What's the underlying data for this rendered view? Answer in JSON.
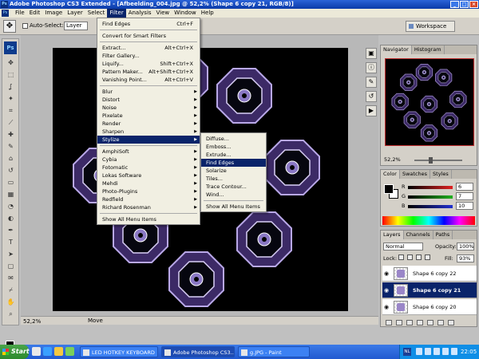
{
  "title": "Adobe Photoshop CS3 Extended - [Afbeelding_004.jpg @ 52,2% (Shape 6 copy 21, RGB/8)]",
  "app_logo": "Ps",
  "menubar": [
    "File",
    "Edit",
    "Image",
    "Layer",
    "Select",
    "Filter",
    "Analysis",
    "View",
    "Window",
    "Help"
  ],
  "options": {
    "auto_select_label": "Auto-Select:",
    "auto_select_value": "Layer",
    "workspace": "Workspace"
  },
  "filter_menu": {
    "items": [
      {
        "label": "Find Edges",
        "shortcut": "Ctrl+F"
      },
      {
        "sep": true
      },
      {
        "label": "Convert for Smart Filters"
      },
      {
        "sep": true
      },
      {
        "label": "Extract...",
        "shortcut": "Alt+Ctrl+X"
      },
      {
        "label": "Filter Gallery..."
      },
      {
        "label": "Liquify...",
        "shortcut": "Shift+Ctrl+X"
      },
      {
        "label": "Pattern Maker...",
        "shortcut": "Alt+Shift+Ctrl+X"
      },
      {
        "label": "Vanishing Point...",
        "shortcut": "Alt+Ctrl+V"
      },
      {
        "sep": true
      },
      {
        "label": "Blur",
        "sub": true
      },
      {
        "label": "Distort",
        "sub": true
      },
      {
        "label": "Noise",
        "sub": true
      },
      {
        "label": "Pixelate",
        "sub": true
      },
      {
        "label": "Render",
        "sub": true
      },
      {
        "label": "Sharpen",
        "sub": true
      },
      {
        "label": "Stylize",
        "sub": true,
        "highlight": true
      },
      {
        "sep": true
      },
      {
        "label": "AmphiSoft",
        "sub": true
      },
      {
        "label": "Cybia",
        "sub": true
      },
      {
        "label": "Fotomatic",
        "sub": true
      },
      {
        "label": "Lokas Software",
        "sub": true
      },
      {
        "label": "Mehdi",
        "sub": true
      },
      {
        "label": "Photo-Plugins",
        "sub": true
      },
      {
        "label": "Redfield",
        "sub": true
      },
      {
        "label": "Richard Rosenman",
        "sub": true
      },
      {
        "sep": true
      },
      {
        "label": "Show All Menu Items"
      }
    ]
  },
  "stylize_menu": {
    "items": [
      {
        "label": "Diffuse..."
      },
      {
        "label": "Emboss..."
      },
      {
        "label": "Extrude..."
      },
      {
        "label": "Find Edges",
        "highlight": true
      },
      {
        "label": "Solarize"
      },
      {
        "label": "Tiles..."
      },
      {
        "label": "Trace Contour..."
      },
      {
        "label": "Wind..."
      },
      {
        "sep": true
      },
      {
        "label": "Show All Menu Items"
      }
    ]
  },
  "status": {
    "zoom": "52,2%",
    "mode": "Move"
  },
  "navigator": {
    "tabs": [
      "Navigator",
      "Histogram"
    ],
    "zoom": "52,2%"
  },
  "color_panel": {
    "tabs": [
      "Color",
      "Swatches",
      "Styles"
    ],
    "channels": [
      {
        "label": "R",
        "value": "6",
        "color": "#e02020"
      },
      {
        "label": "G",
        "value": "7",
        "color": "#20b020"
      },
      {
        "label": "B",
        "value": "10",
        "color": "#2030d0"
      }
    ]
  },
  "layers_panel": {
    "tabs": [
      "Layers",
      "Channels",
      "Paths"
    ],
    "blend_mode": "Normal",
    "opacity_label": "Opacity:",
    "opacity": "100%",
    "lock_label": "Lock:",
    "fill_label": "Fill:",
    "fill": "93%",
    "layers": [
      {
        "name": "Shape 6 copy 22",
        "selected": false
      },
      {
        "name": "Shape 6 copy 21",
        "selected": true
      },
      {
        "name": "Shape 6 copy 20",
        "selected": false
      }
    ]
  },
  "taskbar": {
    "start": "Start",
    "tasks": [
      {
        "label": "LED HOTKEY KEYBOARD",
        "active": false
      },
      {
        "label": "Adobe Photoshop CS3...",
        "active": true
      },
      {
        "label": "g.JPG - Paint",
        "active": false
      }
    ],
    "lang": "NL",
    "clock": "22:05"
  },
  "colors": {
    "accent": "#0a246a",
    "canvas_bg": "#000000",
    "pattern": "#8a78c4"
  }
}
